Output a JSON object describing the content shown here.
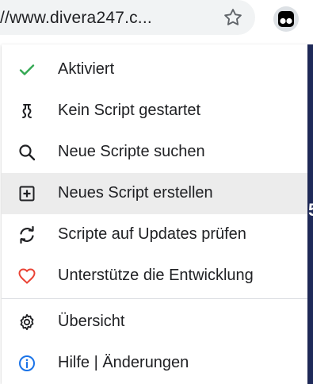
{
  "browser": {
    "url_text": "//www.divera247.c...",
    "icons": {
      "bookmark": "star-outline-icon",
      "extension": "tampermonkey-icon"
    }
  },
  "menu": {
    "items": [
      {
        "label": "Aktiviert",
        "icon": "checkmark-icon",
        "color": "#34a853"
      },
      {
        "label": "Kein Script gestartet",
        "icon": "script-icon",
        "color": "#202124"
      },
      {
        "label": "Neue Scripte suchen",
        "icon": "search-icon",
        "color": "#202124"
      },
      {
        "label": "Neues Script erstellen",
        "icon": "add-box-icon",
        "color": "#202124",
        "highlighted": true
      },
      {
        "label": "Scripte auf Updates prüfen",
        "icon": "refresh-icon",
        "color": "#202124"
      },
      {
        "label": "Unterstütze die Entwicklung",
        "icon": "heart-icon",
        "color": "#ea4335"
      },
      {
        "label": "Übersicht",
        "icon": "gear-icon",
        "color": "#202124"
      },
      {
        "label": "Hilfe | Änderungen",
        "icon": "info-icon",
        "color": "#1a73e8"
      }
    ]
  },
  "page_behind": {
    "partial_text": "5"
  }
}
